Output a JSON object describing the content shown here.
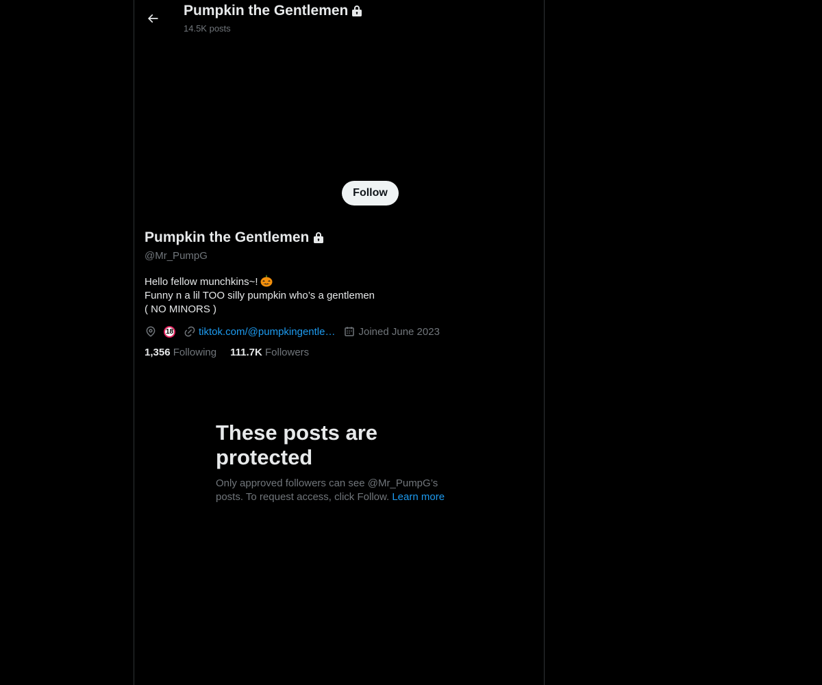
{
  "header": {
    "title": "Pumpkin the Gentlemen",
    "post_count": "14.5K posts",
    "back_icon": "arrow-left-icon",
    "lock_icon": "lock-icon"
  },
  "profile": {
    "display_name": "Pumpkin the Gentlemen",
    "handle": "@Mr_PumpG",
    "bio_lines": [
      "Hello fellow munchkins~!",
      "Funny n a lil TOO silly pumpkin who’s a gentlemen",
      "( NO MINORS )"
    ],
    "bio_emoji": "jack-o-lantern-icon",
    "location_badge": "18",
    "website": "tiktok.com/@pumpkingentle…",
    "joined": "Joined June 2023",
    "following_count": "1,356",
    "following_label": "Following",
    "followers_count": "111.7K",
    "followers_label": "Followers"
  },
  "actions": {
    "follow_label": "Follow"
  },
  "protected": {
    "title": "These posts are protected",
    "text": "Only approved followers can see @Mr_PumpG’s posts. To request access, click Follow.",
    "learn_more": "Learn more"
  },
  "colors": {
    "background": "#000000",
    "text_primary": "#e7e9ea",
    "text_secondary": "#71767b",
    "link": "#1d9bf0",
    "follow_button_bg": "#eff3f4",
    "border": "#2f3336"
  }
}
